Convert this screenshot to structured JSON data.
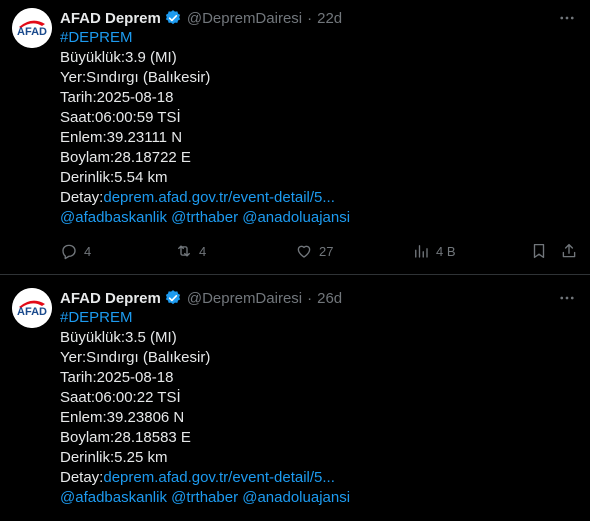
{
  "tweets": [
    {
      "author": "AFAD Deprem",
      "handle": "@DepremDairesi",
      "separator": "·",
      "time": "22d",
      "avatar_text": "AFAD",
      "hashtag": "#DEPREM",
      "lines": {
        "magnitude": "Büyüklük:3.9 (MI)",
        "location": "Yer:Sındırgı (Balıkesir)",
        "date": "Tarih:2025-08-18",
        "clock": "Saat:06:00:59 TSİ",
        "latitude": "Enlem:39.23111 N",
        "longitude": "Boylam:28.18722 E",
        "depth": "Derinlik:5.54 km",
        "detail_label": "Detay:",
        "detail_link": "deprem.afad.gov.tr/event-detail/5..."
      },
      "mentions": [
        "@afadbaskanlik",
        "@trthaber",
        "@anadoluajansi"
      ],
      "stats": {
        "replies": "4",
        "reposts": "4",
        "likes": "27",
        "views": "4 B"
      }
    },
    {
      "author": "AFAD Deprem",
      "handle": "@DepremDairesi",
      "separator": "·",
      "time": "26d",
      "avatar_text": "AFAD",
      "hashtag": "#DEPREM",
      "lines": {
        "magnitude": "Büyüklük:3.5 (MI)",
        "location": "Yer:Sındırgı (Balıkesir)",
        "date": "Tarih:2025-08-18",
        "clock": "Saat:06:00:22 TSİ",
        "latitude": "Enlem:39.23806 N",
        "longitude": "Boylam:28.18583 E",
        "depth": "Derinlik:5.25 km",
        "detail_label": "Detay:",
        "detail_link": "deprem.afad.gov.tr/event-detail/5..."
      },
      "mentions": [
        "@afadbaskanlik",
        "@trthaber",
        "@anadoluajansi"
      ]
    }
  ],
  "colors": {
    "background": "#000000",
    "text": "#e7e9ea",
    "muted": "#71767b",
    "link": "#1d9bf0",
    "avatar_red": "#e30a17",
    "avatar_blue": "#1a4a8c"
  },
  "icons": [
    "afad-logo",
    "verified-badge-icon",
    "more-icon",
    "reply-icon",
    "repost-icon",
    "like-icon",
    "views-icon",
    "bookmark-icon",
    "share-icon"
  ]
}
